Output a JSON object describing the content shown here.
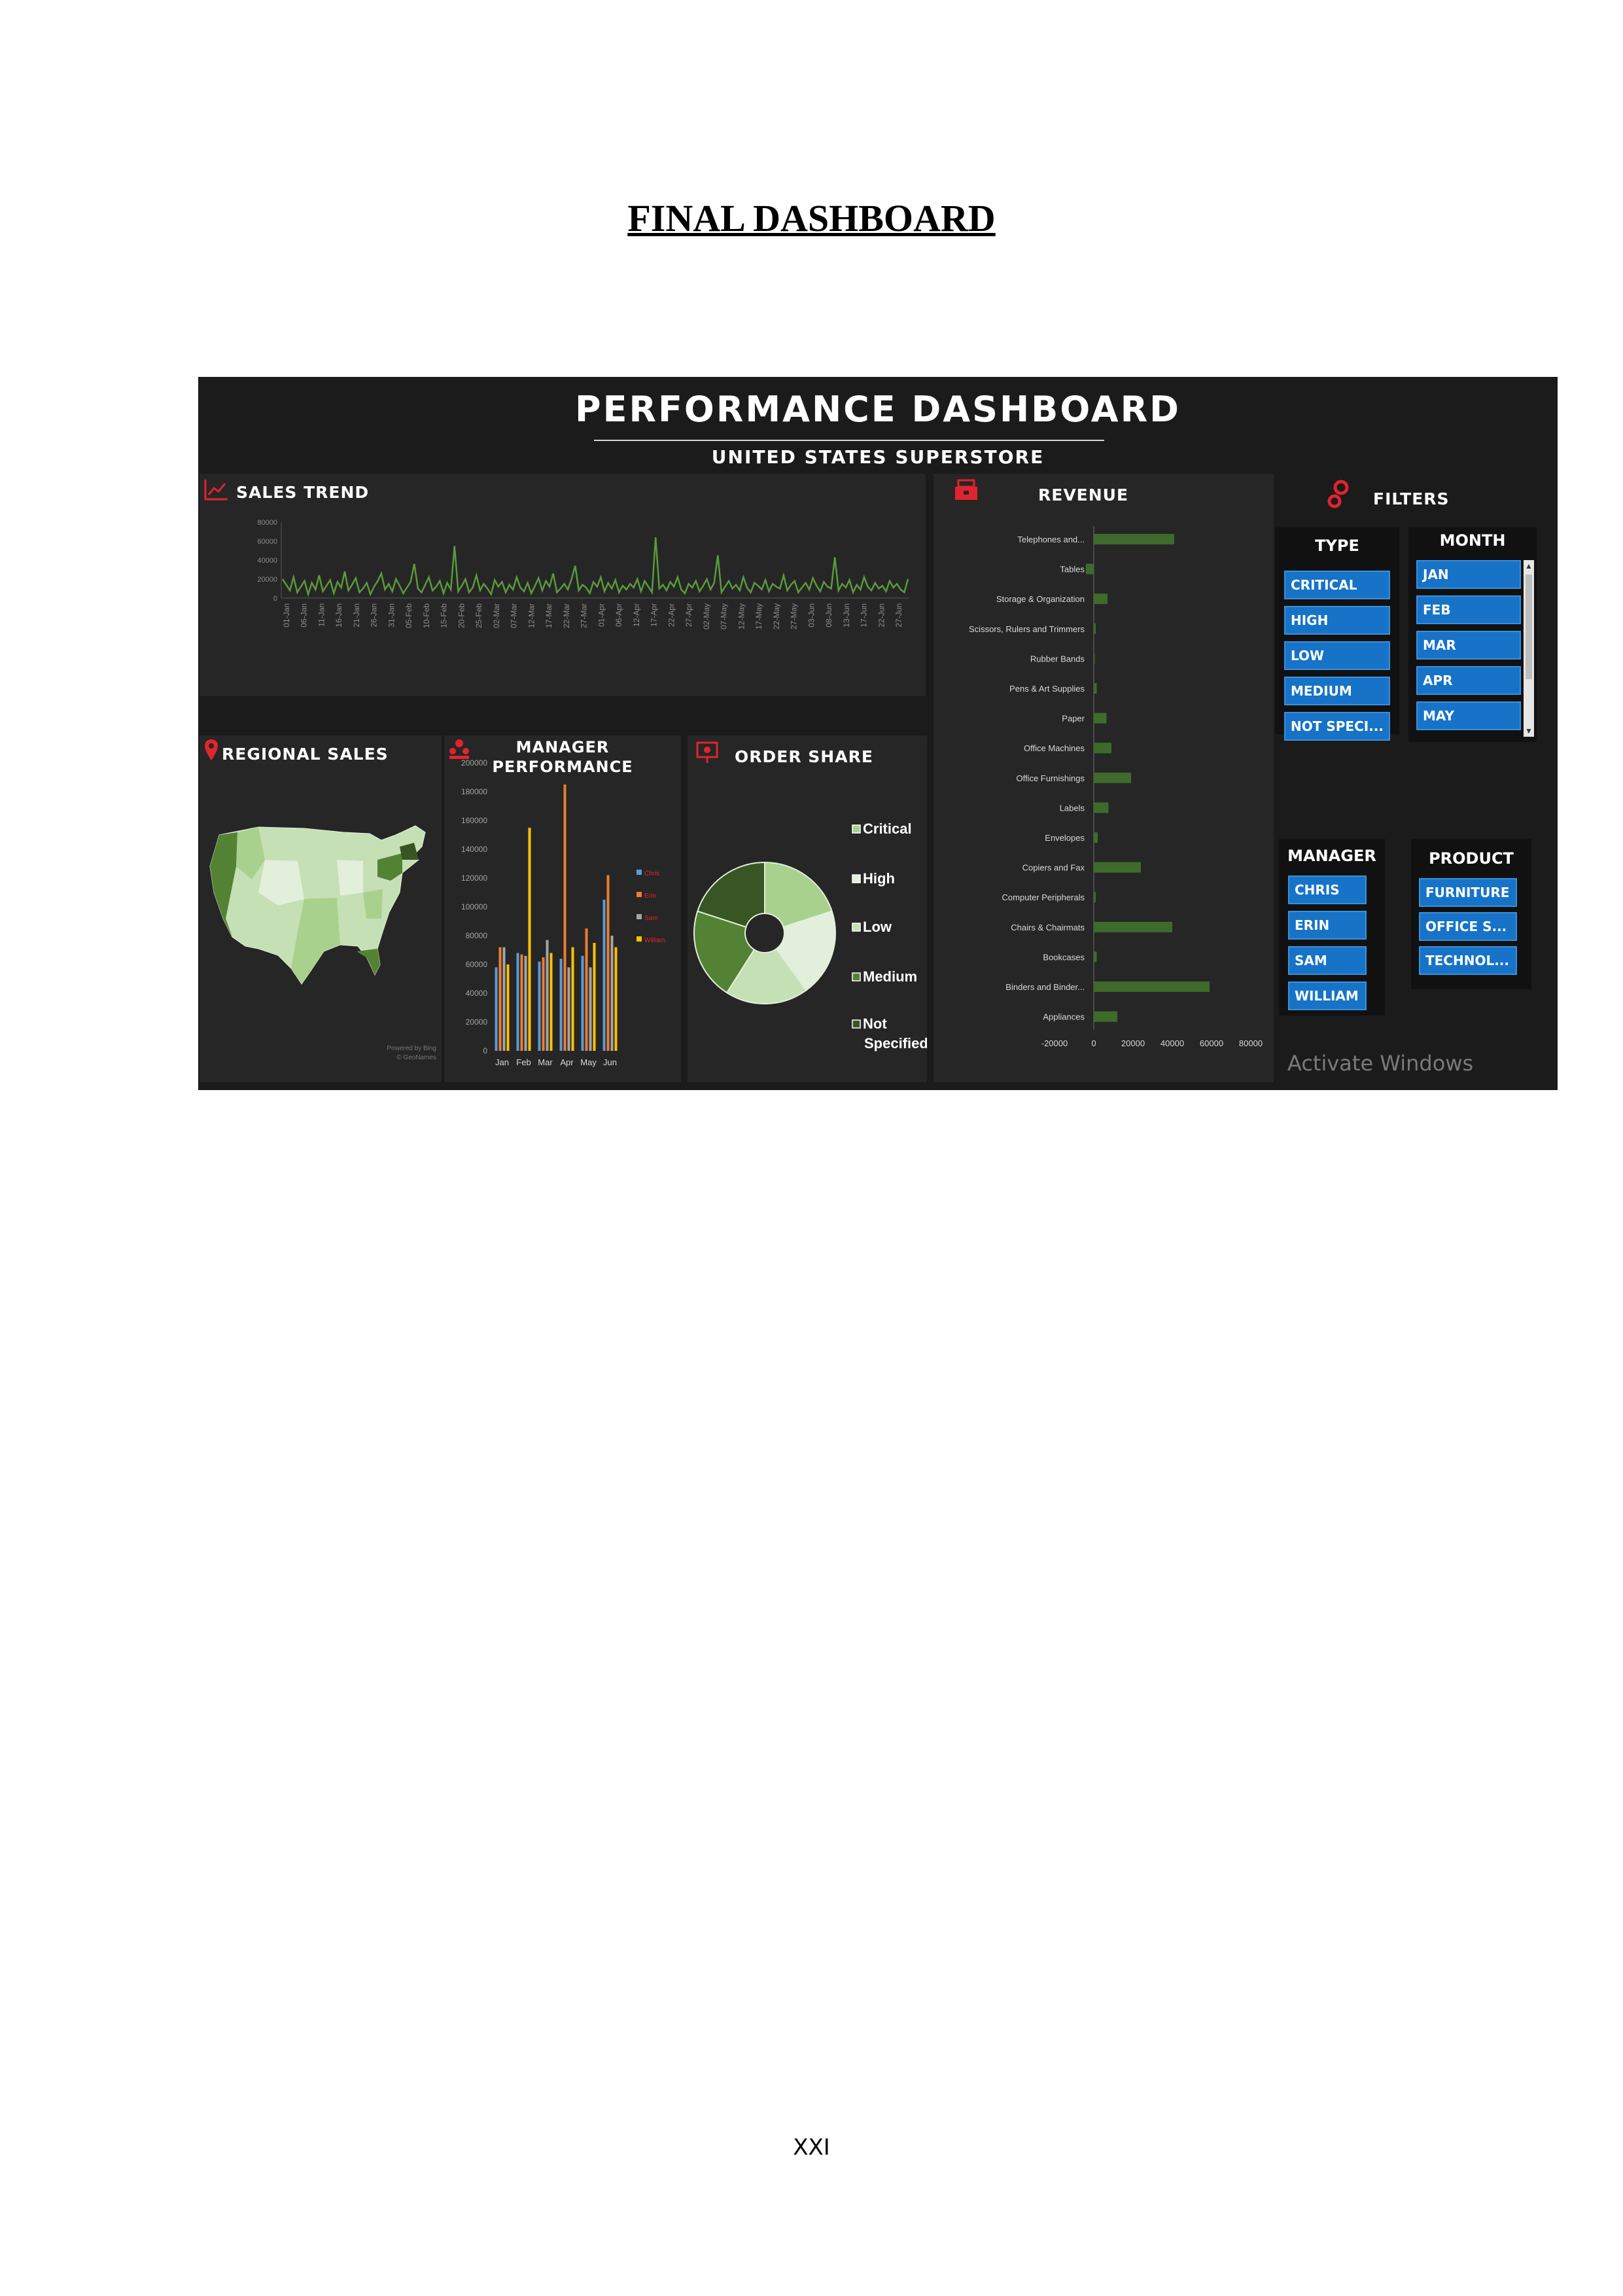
{
  "document": {
    "heading": "FINAL DASHBOARD",
    "page_number": "XXI"
  },
  "dashboard": {
    "title": "PERFORMANCE DASHBOARD",
    "subtitle": "UNITED STATES SUPERSTORE",
    "watermark": "Activate Windows",
    "panels": {
      "sales_trend": "SALES TREND",
      "regional_sales": "REGIONAL SALES",
      "manager_performance_line1": "MANAGER",
      "manager_performance_line2": "PERFORMANCE",
      "order_share": "ORDER SHARE",
      "revenue": "REVENUE",
      "filters": "FILTERS"
    },
    "map_attribution": [
      "Powered by Bing",
      "© GeoNames"
    ],
    "colors": {
      "background": "#1b1b1b",
      "panel": "#262626",
      "accent_red": "#e0242e",
      "trend_green": "#5a9a3c",
      "revenue_bar": "#3e6b2c",
      "slicer_button": "#1673c8"
    }
  },
  "filters": {
    "type": {
      "title": "TYPE",
      "options": [
        "CRITICAL",
        "HIGH",
        "LOW",
        "MEDIUM",
        "NOT SPECI..."
      ]
    },
    "month": {
      "title": "MONTH",
      "options": [
        "JAN",
        "FEB",
        "MAR",
        "APR",
        "MAY"
      ]
    },
    "manager": {
      "title": "MANAGER",
      "options": [
        "CHRIS",
        "ERIN",
        "SAM",
        "WILLIAM"
      ]
    },
    "product": {
      "title": "PRODUCT",
      "options": [
        "FURNITURE",
        "OFFICE S...",
        "TECHNOL..."
      ]
    }
  },
  "chart_data": [
    {
      "id": "sales_trend",
      "type": "line",
      "title": "SALES TREND",
      "ylim": [
        0,
        80000
      ],
      "yticks": [
        0,
        20000,
        40000,
        60000,
        80000
      ],
      "xticks": [
        "01-Jan",
        "06-Jan",
        "11-Jan",
        "16-Jan",
        "21-Jan",
        "26-Jan",
        "31-Jan",
        "05-Feb",
        "10-Feb",
        "15-Feb",
        "20-Feb",
        "25-Feb",
        "02-Mar",
        "07-Mar",
        "12-Mar",
        "17-Mar",
        "22-Mar",
        "27-Mar",
        "01-Apr",
        "06-Apr",
        "12-Apr",
        "17-Apr",
        "22-Apr",
        "27-Apr",
        "02-May",
        "07-May",
        "12-May",
        "17-May",
        "22-May",
        "27-May",
        "03-Jun",
        "08-Jun",
        "13-Jun",
        "17-Jun",
        "22-Jun",
        "27-Jun"
      ],
      "values": [
        20000,
        14000,
        8000,
        22000,
        6000,
        12000,
        18000,
        4000,
        16000,
        9000,
        24000,
        7000,
        13000,
        19000,
        5000,
        17000,
        11000,
        28000,
        8000,
        14000,
        21000,
        6000,
        10000,
        16000,
        4000,
        12000,
        18000,
        26000,
        9000,
        15000,
        7000,
        20000,
        13000,
        5000,
        11000,
        17000,
        36000,
        10000,
        6000,
        14000,
        22000,
        8000,
        12000,
        18000,
        5000,
        16000,
        9000,
        55000,
        7000,
        13000,
        20000,
        6000,
        11000,
        24000,
        8000,
        15000,
        10000,
        4000,
        19000,
        12000,
        17000,
        6000,
        14000,
        9000,
        22000,
        11000,
        7000,
        16000,
        5000,
        13000,
        21000,
        8000,
        18000,
        12000,
        26000,
        6000,
        10000,
        15000,
        9000,
        20000,
        34000,
        8000,
        14000,
        11000,
        5000,
        17000,
        12000,
        22000,
        7000,
        16000,
        10000,
        19000,
        6000,
        13000,
        9000,
        15000,
        11000,
        20000,
        7000,
        18000,
        12000,
        6000,
        64000,
        10000,
        14000,
        8000,
        17000,
        12000,
        22000,
        9000,
        5000,
        15000,
        11000,
        18000,
        7000,
        13000,
        20000,
        9000,
        16000,
        45000,
        6000,
        12000,
        18000,
        10000,
        14000,
        8000,
        22000,
        11000,
        6000,
        16000,
        13000,
        9000,
        19000,
        7000,
        15000,
        12000,
        10000,
        24000,
        8000,
        14000,
        18000,
        6000,
        11000,
        16000,
        9000,
        21000,
        13000,
        7000,
        17000,
        12000,
        10000,
        43000,
        8000,
        15000,
        11000,
        19000,
        6000,
        14000,
        9000,
        22000,
        12000,
        8000,
        16000,
        10000,
        13000,
        7000,
        18000,
        11000,
        15000,
        9000,
        6000,
        20000
      ]
    },
    {
      "id": "manager_performance",
      "type": "bar",
      "title": "MANAGER PERFORMANCE",
      "categories": [
        "Jan",
        "Feb",
        "Mar",
        "Apr",
        "May",
        "Jun"
      ],
      "ylim": [
        0,
        200000
      ],
      "yticks": [
        0,
        20000,
        40000,
        60000,
        80000,
        100000,
        120000,
        140000,
        160000,
        180000,
        200000
      ],
      "series": [
        {
          "name": "Chris",
          "color": "#5b9bd5",
          "values": [
            58000,
            68000,
            62000,
            64000,
            66000,
            105000
          ]
        },
        {
          "name": "Erin",
          "color": "#ed7d31",
          "values": [
            72000,
            67000,
            65000,
            185000,
            85000,
            122000
          ]
        },
        {
          "name": "Sam",
          "color": "#a5a5a5",
          "values": [
            72000,
            66000,
            77000,
            58000,
            58000,
            80000
          ]
        },
        {
          "name": "William",
          "color": "#ffc000",
          "values": [
            60000,
            155000,
            68000,
            72000,
            75000,
            72000
          ]
        }
      ]
    },
    {
      "id": "order_share",
      "type": "pie",
      "title": "ORDER SHARE",
      "labels": [
        "Critical",
        "High",
        "Low",
        "Medium",
        "Not Specified"
      ],
      "values": [
        20,
        20,
        19,
        21,
        20
      ],
      "colors": [
        "#a9d18e",
        "#e2efda",
        "#c5e0b4",
        "#548235",
        "#375623"
      ]
    },
    {
      "id": "revenue",
      "type": "bar",
      "orientation": "horizontal",
      "title": "REVENUE",
      "categories": [
        "Telephones and...",
        "Tables",
        "Storage & Organization",
        "Scissors, Rulers and Trimmers",
        "Rubber Bands",
        "Pens & Art Supplies",
        "Paper",
        "Office Machines",
        "Office Furnishings",
        "Labels",
        "Envelopes",
        "Copiers and Fax",
        "Computer Peripherals",
        "Chairs & Chairmats",
        "Bookcases",
        "Binders and Binder...",
        "Appliances"
      ],
      "values": [
        41000,
        -4000,
        7000,
        1000,
        500,
        1500,
        6500,
        9000,
        19000,
        7500,
        2000,
        24000,
        1000,
        40000,
        1500,
        59000,
        12000
      ],
      "xlim": [
        -20000,
        80000
      ],
      "xticks": [
        -20000,
        0,
        20000,
        40000,
        60000,
        80000
      ]
    }
  ]
}
